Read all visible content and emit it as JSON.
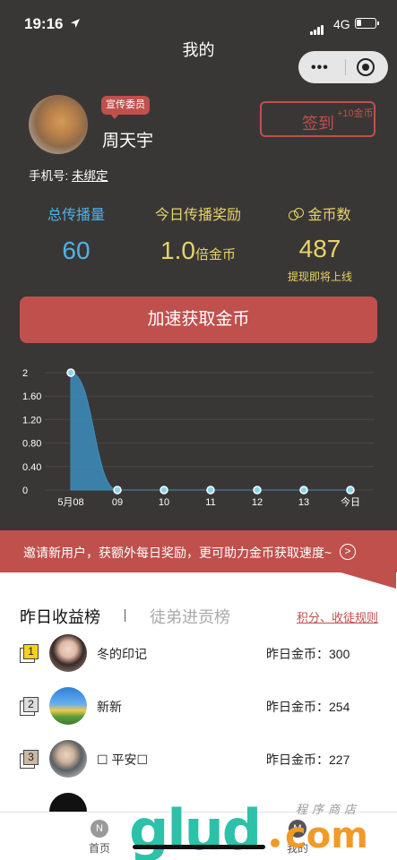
{
  "status_bar": {
    "time": "19:16",
    "network": "4G"
  },
  "nav": {
    "title": "我的"
  },
  "profile": {
    "role_badge": "宣传委员",
    "name": "周天宇",
    "phone_label": "手机号:",
    "phone_value": "未绑定",
    "signin_label": "签到",
    "signin_bonus": "+10金币"
  },
  "stats": [
    {
      "title": "总传播量",
      "value": "60",
      "color": "#4fb3e6"
    },
    {
      "title": "今日传播奖励",
      "value": "1.0",
      "unit": "倍金币",
      "color": "#e8d36a"
    },
    {
      "title": "金币数",
      "value": "487",
      "note": "提现即将上线",
      "color": "#e8d36a"
    }
  ],
  "cta_label": "加速获取金币",
  "chart_data": {
    "type": "area",
    "x": [
      "5月08",
      "09",
      "10",
      "11",
      "12",
      "13",
      "今日"
    ],
    "series": [
      {
        "values": [
          2,
          0,
          0,
          0,
          0,
          0,
          0
        ]
      }
    ],
    "yticks": [
      "0",
      "0.40",
      "0.80",
      "1.20",
      "1.60",
      "2"
    ],
    "ylim": [
      0,
      2
    ],
    "grid": true,
    "colors": {
      "fill": "#3b8dbd",
      "point": "#88d3f2"
    }
  },
  "banner_text": "邀请新用户，获额外每日奖励，更可助力金币获取速度~",
  "leaderboard": {
    "tab_active": "昨日收益榜",
    "tab_inactive": "徒弟进贡榜",
    "rules_link": "积分、收徒规则",
    "gold_label": "昨日金币：",
    "rows": [
      {
        "rank": "1",
        "name": "冬的印记",
        "gold": "300"
      },
      {
        "rank": "2",
        "name": "新新",
        "gold": "254"
      },
      {
        "rank": "3",
        "name": "☐ 平安☐",
        "gold": "227"
      }
    ]
  },
  "tabbar": [
    {
      "icon": "N",
      "label": "首页"
    },
    {
      "icon": "M",
      "label": "我的"
    }
  ],
  "watermark": {
    "logo": "glud",
    "suffix": "com",
    "cn": "程序商店"
  },
  "colors": {
    "accent": "#c0504c",
    "dark_bg": "#393736",
    "blue": "#4fb3e6",
    "gold": "#e8d36a"
  }
}
